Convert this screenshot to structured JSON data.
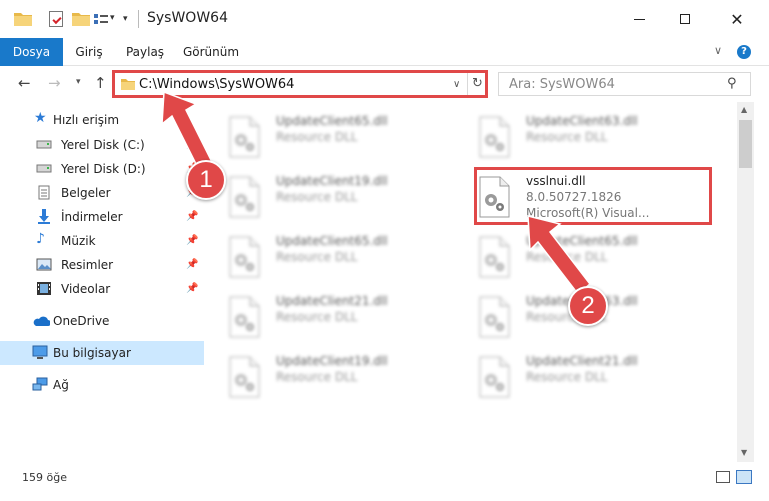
{
  "window": {
    "title": "SysWOW64"
  },
  "ribbon": {
    "tabs": [
      {
        "label": "Dosya"
      },
      {
        "label": "Giriş"
      },
      {
        "label": "Paylaş"
      },
      {
        "label": "Görünüm"
      }
    ]
  },
  "nav": {
    "address": "C:\\Windows\\SysWOW64",
    "search_placeholder": "Ara: SysWOW64"
  },
  "sidebar": {
    "quick_access": "Hızlı erişim",
    "items": [
      {
        "label": "Yerel Disk (C:)",
        "icon": "drive-icon"
      },
      {
        "label": "Yerel Disk (D:)",
        "icon": "drive-icon"
      },
      {
        "label": "Belgeler",
        "icon": "documents-icon"
      },
      {
        "label": "İndirmeler",
        "icon": "download-icon"
      },
      {
        "label": "Müzik",
        "icon": "music-icon"
      },
      {
        "label": "Resimler",
        "icon": "pictures-icon"
      },
      {
        "label": "Videolar",
        "icon": "videos-icon"
      }
    ],
    "onedrive": "OneDrive",
    "this_pc": "Bu bilgisayar",
    "network": "Ağ"
  },
  "files": [
    {
      "name": "UpdateClient65.dll",
      "desc": "Resource DLL",
      "blurred": true
    },
    {
      "name": "UpdateClient63.dll",
      "desc": "Resource DLL",
      "blurred": true
    },
    {
      "name": "UpdateClient19.dll",
      "desc": "Resource DLL",
      "blurred": true
    },
    {
      "name": "vsslnui.dll",
      "version": "8.0.50727.1826",
      "company": "Microsoft(R) Visual...",
      "blurred": false
    },
    {
      "name": "UpdateClient65.dll",
      "desc": "Resource DLL",
      "blurred": true
    },
    {
      "name": "UpdateClient65.dll",
      "desc": "Resource DLL",
      "blurred": true
    },
    {
      "name": "UpdateClient21.dll",
      "desc": "Resource DLL",
      "blurred": true
    },
    {
      "name": "UpdateClient63.dll",
      "desc": "Resource DLL",
      "blurred": true
    },
    {
      "name": "UpdateClient19.dll",
      "desc": "Resource DLL",
      "blurred": true
    },
    {
      "name": "UpdateClient21.dll",
      "desc": "Resource DLL",
      "blurred": true
    }
  ],
  "status": {
    "item_count": "159 öğe"
  },
  "annotations": {
    "badge1": "1",
    "badge2": "2"
  },
  "colors": {
    "accent": "#1979ca",
    "annotation": "#e04848",
    "selected": "#cce8ff"
  }
}
